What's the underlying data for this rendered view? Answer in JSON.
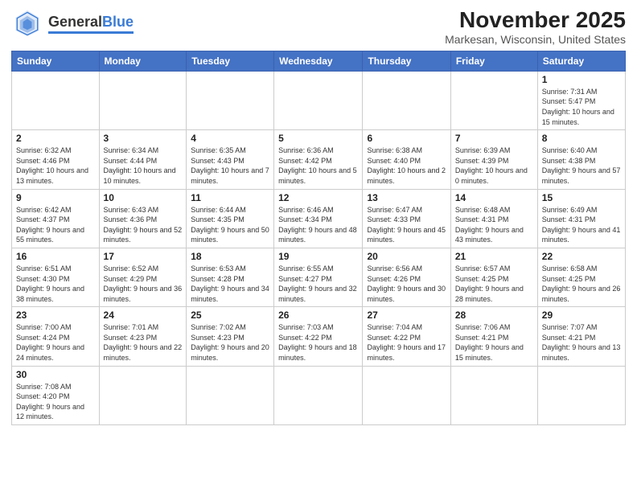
{
  "header": {
    "title": "November 2025",
    "subtitle": "Markesan, Wisconsin, United States",
    "logo_general": "General",
    "logo_blue": "Blue"
  },
  "days_of_week": [
    "Sunday",
    "Monday",
    "Tuesday",
    "Wednesday",
    "Thursday",
    "Friday",
    "Saturday"
  ],
  "weeks": [
    [
      {
        "day": "",
        "info": ""
      },
      {
        "day": "",
        "info": ""
      },
      {
        "day": "",
        "info": ""
      },
      {
        "day": "",
        "info": ""
      },
      {
        "day": "",
        "info": ""
      },
      {
        "day": "",
        "info": ""
      },
      {
        "day": "1",
        "info": "Sunrise: 7:31 AM\nSunset: 5:47 PM\nDaylight: 10 hours and 15 minutes."
      }
    ],
    [
      {
        "day": "2",
        "info": "Sunrise: 6:32 AM\nSunset: 4:46 PM\nDaylight: 10 hours and 13 minutes."
      },
      {
        "day": "3",
        "info": "Sunrise: 6:34 AM\nSunset: 4:44 PM\nDaylight: 10 hours and 10 minutes."
      },
      {
        "day": "4",
        "info": "Sunrise: 6:35 AM\nSunset: 4:43 PM\nDaylight: 10 hours and 7 minutes."
      },
      {
        "day": "5",
        "info": "Sunrise: 6:36 AM\nSunset: 4:42 PM\nDaylight: 10 hours and 5 minutes."
      },
      {
        "day": "6",
        "info": "Sunrise: 6:38 AM\nSunset: 4:40 PM\nDaylight: 10 hours and 2 minutes."
      },
      {
        "day": "7",
        "info": "Sunrise: 6:39 AM\nSunset: 4:39 PM\nDaylight: 10 hours and 0 minutes."
      },
      {
        "day": "8",
        "info": "Sunrise: 6:40 AM\nSunset: 4:38 PM\nDaylight: 9 hours and 57 minutes."
      }
    ],
    [
      {
        "day": "9",
        "info": "Sunrise: 6:42 AM\nSunset: 4:37 PM\nDaylight: 9 hours and 55 minutes."
      },
      {
        "day": "10",
        "info": "Sunrise: 6:43 AM\nSunset: 4:36 PM\nDaylight: 9 hours and 52 minutes."
      },
      {
        "day": "11",
        "info": "Sunrise: 6:44 AM\nSunset: 4:35 PM\nDaylight: 9 hours and 50 minutes."
      },
      {
        "day": "12",
        "info": "Sunrise: 6:46 AM\nSunset: 4:34 PM\nDaylight: 9 hours and 48 minutes."
      },
      {
        "day": "13",
        "info": "Sunrise: 6:47 AM\nSunset: 4:33 PM\nDaylight: 9 hours and 45 minutes."
      },
      {
        "day": "14",
        "info": "Sunrise: 6:48 AM\nSunset: 4:31 PM\nDaylight: 9 hours and 43 minutes."
      },
      {
        "day": "15",
        "info": "Sunrise: 6:49 AM\nSunset: 4:31 PM\nDaylight: 9 hours and 41 minutes."
      }
    ],
    [
      {
        "day": "16",
        "info": "Sunrise: 6:51 AM\nSunset: 4:30 PM\nDaylight: 9 hours and 38 minutes."
      },
      {
        "day": "17",
        "info": "Sunrise: 6:52 AM\nSunset: 4:29 PM\nDaylight: 9 hours and 36 minutes."
      },
      {
        "day": "18",
        "info": "Sunrise: 6:53 AM\nSunset: 4:28 PM\nDaylight: 9 hours and 34 minutes."
      },
      {
        "day": "19",
        "info": "Sunrise: 6:55 AM\nSunset: 4:27 PM\nDaylight: 9 hours and 32 minutes."
      },
      {
        "day": "20",
        "info": "Sunrise: 6:56 AM\nSunset: 4:26 PM\nDaylight: 9 hours and 30 minutes."
      },
      {
        "day": "21",
        "info": "Sunrise: 6:57 AM\nSunset: 4:25 PM\nDaylight: 9 hours and 28 minutes."
      },
      {
        "day": "22",
        "info": "Sunrise: 6:58 AM\nSunset: 4:25 PM\nDaylight: 9 hours and 26 minutes."
      }
    ],
    [
      {
        "day": "23",
        "info": "Sunrise: 7:00 AM\nSunset: 4:24 PM\nDaylight: 9 hours and 24 minutes."
      },
      {
        "day": "24",
        "info": "Sunrise: 7:01 AM\nSunset: 4:23 PM\nDaylight: 9 hours and 22 minutes."
      },
      {
        "day": "25",
        "info": "Sunrise: 7:02 AM\nSunset: 4:23 PM\nDaylight: 9 hours and 20 minutes."
      },
      {
        "day": "26",
        "info": "Sunrise: 7:03 AM\nSunset: 4:22 PM\nDaylight: 9 hours and 18 minutes."
      },
      {
        "day": "27",
        "info": "Sunrise: 7:04 AM\nSunset: 4:22 PM\nDaylight: 9 hours and 17 minutes."
      },
      {
        "day": "28",
        "info": "Sunrise: 7:06 AM\nSunset: 4:21 PM\nDaylight: 9 hours and 15 minutes."
      },
      {
        "day": "29",
        "info": "Sunrise: 7:07 AM\nSunset: 4:21 PM\nDaylight: 9 hours and 13 minutes."
      }
    ],
    [
      {
        "day": "30",
        "info": "Sunrise: 7:08 AM\nSunset: 4:20 PM\nDaylight: 9 hours and 12 minutes."
      },
      {
        "day": "",
        "info": ""
      },
      {
        "day": "",
        "info": ""
      },
      {
        "day": "",
        "info": ""
      },
      {
        "day": "",
        "info": ""
      },
      {
        "day": "",
        "info": ""
      },
      {
        "day": "",
        "info": ""
      }
    ]
  ]
}
